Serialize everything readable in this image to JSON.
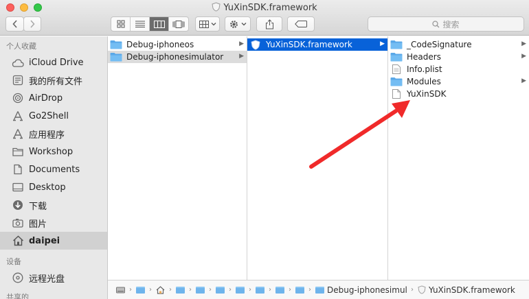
{
  "window": {
    "title": "YuXinSDK.framework"
  },
  "toolbar": {
    "search_placeholder": "搜索"
  },
  "sidebar": {
    "favorites_header": "个人收藏",
    "favorites": [
      {
        "label": "iCloud Drive",
        "icon": "cloud-icon"
      },
      {
        "label": "我的所有文件",
        "icon": "all-files-icon"
      },
      {
        "label": "AirDrop",
        "icon": "airdrop-icon"
      },
      {
        "label": "Go2Shell",
        "icon": "applications-icon"
      },
      {
        "label": "应用程序",
        "icon": "applications-icon"
      },
      {
        "label": "Workshop",
        "icon": "folder-icon"
      },
      {
        "label": "Documents",
        "icon": "documents-icon"
      },
      {
        "label": "Desktop",
        "icon": "desktop-icon"
      },
      {
        "label": "下载",
        "icon": "downloads-icon"
      },
      {
        "label": "图片",
        "icon": "pictures-icon"
      },
      {
        "label": "daipei",
        "icon": "home-icon"
      }
    ],
    "devices_header": "设备",
    "devices": [
      {
        "label": "远程光盘",
        "icon": "disc-icon"
      }
    ],
    "shared_header": "共享的"
  },
  "columns": [
    {
      "items": [
        {
          "label": "Debug-iphoneos",
          "icon": "folder-icon",
          "state": "normal"
        },
        {
          "label": "Debug-iphonesimulator",
          "icon": "folder-icon",
          "state": "dim"
        }
      ]
    },
    {
      "items": [
        {
          "label": "YuXinSDK.framework",
          "icon": "framework-icon",
          "state": "selected"
        }
      ]
    },
    {
      "items": [
        {
          "label": "_CodeSignature",
          "icon": "folder-icon",
          "state": "normal"
        },
        {
          "label": "Headers",
          "icon": "folder-icon",
          "state": "normal"
        },
        {
          "label": "Info.plist",
          "icon": "plist-file-icon",
          "state": "normal"
        },
        {
          "label": "Modules",
          "icon": "folder-icon",
          "state": "normal"
        },
        {
          "label": "YuXinSDK",
          "icon": "document-icon",
          "state": "normal"
        }
      ]
    }
  ],
  "pathbar": {
    "items": [
      "Debug-iphonesimulator",
      "YuXinSDK.framework"
    ]
  },
  "colors": {
    "selection": "#0862d9",
    "folder": "#6eb4ec",
    "annotation_arrow": "#f02a2a"
  }
}
